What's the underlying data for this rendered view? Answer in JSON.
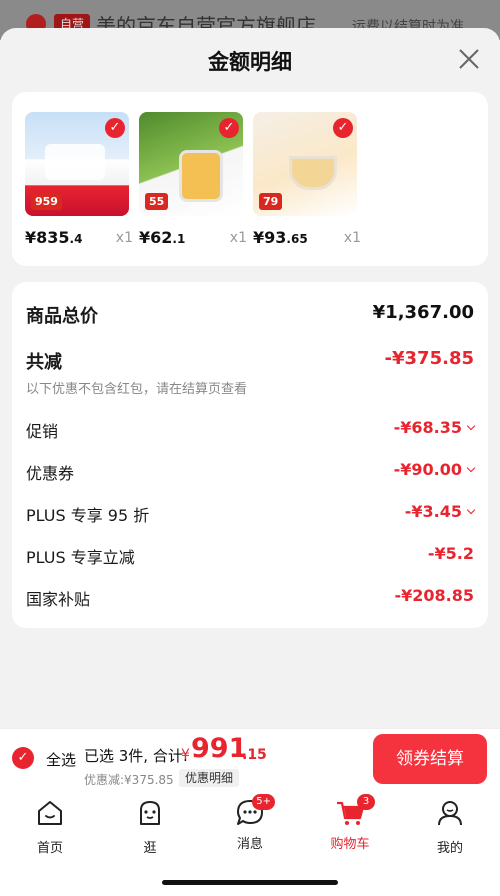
{
  "background": {
    "badge": "自营",
    "store_title": "美的京东自营官方旗舰店",
    "note": "运费以结算时为准"
  },
  "sheet": {
    "title": "金额明细",
    "close_icon": "close-icon"
  },
  "products": [
    {
      "price_int": "¥835",
      "price_dec": ".4",
      "qty": "x1",
      "tag": "959"
    },
    {
      "price_int": "¥62",
      "price_dec": ".1",
      "qty": "x1",
      "tag": "55"
    },
    {
      "price_int": "¥93",
      "price_dec": ".65",
      "qty": "x1",
      "tag": "79"
    }
  ],
  "summary": {
    "total_label": "商品总价",
    "total_value": "¥1,367.00",
    "reduce_label": "共减",
    "reduce_value": "-¥375.85",
    "note": "以下优惠不包含红包，请在结算页查看",
    "items": [
      {
        "label": "促销",
        "value": "-¥68.35",
        "expandable": true
      },
      {
        "label": "优惠券",
        "value": "-¥90.00",
        "expandable": true
      },
      {
        "label": "PLUS 专享 95 折",
        "value": "-¥3.45",
        "expandable": true
      },
      {
        "label": "PLUS 专享立减",
        "value": "-¥5.2",
        "expandable": false
      },
      {
        "label": "国家补贴",
        "value": "-¥208.85",
        "expandable": false
      }
    ]
  },
  "checkout": {
    "select_all": "全选",
    "selected_text": "已选 3件, 合计:",
    "currency": "¥",
    "total_int": "991",
    "total_dec": ".15",
    "discount_text": "优惠减:¥375.85",
    "detail_label": "优惠明细",
    "checkout_label": "领券结算"
  },
  "tabbar": [
    {
      "label": "首页",
      "icon": "home-icon"
    },
    {
      "label": "逛",
      "icon": "explore-icon"
    },
    {
      "label": "消息",
      "icon": "message-icon",
      "badge": "5+"
    },
    {
      "label": "购物车",
      "icon": "cart-icon",
      "badge": "3",
      "active": true
    },
    {
      "label": "我的",
      "icon": "profile-icon"
    }
  ],
  "colors": {
    "accent": "#e8242f",
    "button": "#f5333f"
  }
}
